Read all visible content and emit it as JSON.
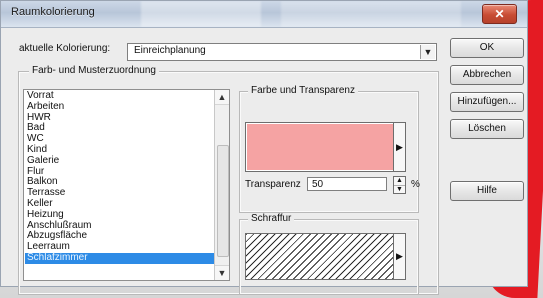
{
  "window": {
    "title": "Raumkolorierung",
    "close_symbol": "✕"
  },
  "form": {
    "aktuelle_kolorierung_label": "aktuelle Kolorierung:",
    "aktuelle_kolorierung_value": "Einreichplanung",
    "farb_muster_group_title": "Farb- und Musterzuordnung",
    "farbe_transparenz_title": "Farbe und Transparenz",
    "transparenz_label": "Transparenz",
    "transparenz_value": "50",
    "transparenz_unit": "%",
    "schraffur_title": "Schraffur"
  },
  "buttons": {
    "ok": "OK",
    "abbrechen": "Abbrechen",
    "hinzufuegen": "Hinzufügen...",
    "loeschen": "Löschen",
    "hilfe": "Hilfe"
  },
  "list": {
    "items": [
      "Vorrat",
      "Arbeiten",
      "HWR",
      "Bad",
      "WC",
      "Kind",
      "Galerie",
      "Flur",
      "Balkon",
      "Terrasse",
      "Keller",
      "Heizung",
      "Anschlußraum",
      "Abzugsfläche",
      "Leerraum",
      "Schlafzimmer"
    ],
    "selected_index": 15
  },
  "colors": {
    "transparency_swatch": "#f5a3a3",
    "selected_row": "#2d8be6",
    "accent_red": "#e41b23"
  },
  "icons": {
    "combo_arrow": "chevron-down-icon",
    "list_scroll_up": "arrow-up-icon",
    "list_scroll_down": "arrow-down-icon",
    "color_picker_arrow": "chevron-right-icon",
    "hatch_picker_arrow": "chevron-right-icon",
    "spin_control": "spin-arrows-icon",
    "close": "close-icon"
  }
}
